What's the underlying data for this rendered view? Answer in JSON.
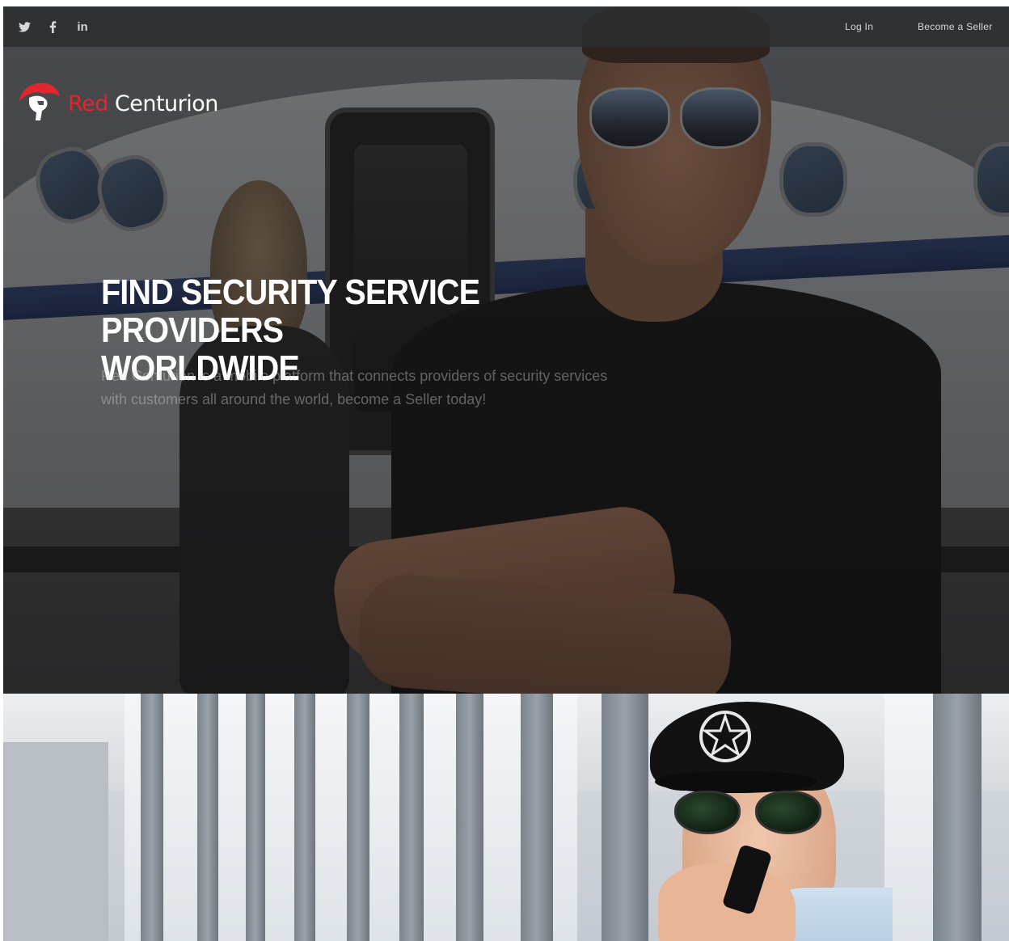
{
  "topbar": {
    "social": [
      {
        "icon": "twitter-icon",
        "glyph": "twitter"
      },
      {
        "icon": "facebook-icon",
        "glyph": "f"
      },
      {
        "icon": "linkedin-icon",
        "glyph": "in"
      }
    ],
    "login_label": "Log In",
    "seller_label": "Become a Seller"
  },
  "logo": {
    "red_text": "Red",
    "white_text": " Centurion",
    "icon": "centurion-helmet-icon"
  },
  "hero": {
    "headline_line1": "FIND SECURITY SERVICE PROVIDERS",
    "headline_line2": "WORLDWIDE",
    "subtext_line1": "Red Centurion is a mobile platform that connects providers of security services",
    "subtext_line2": "with customers all around the world, become a Seller today!",
    "image": "bodyguard-private-jet-photo"
  },
  "section2": {
    "image": "security-guard-radio-photo"
  },
  "colors": {
    "brand_red": "#e3262d",
    "topbar": "#2d2e30",
    "headline": "#ffffff"
  }
}
